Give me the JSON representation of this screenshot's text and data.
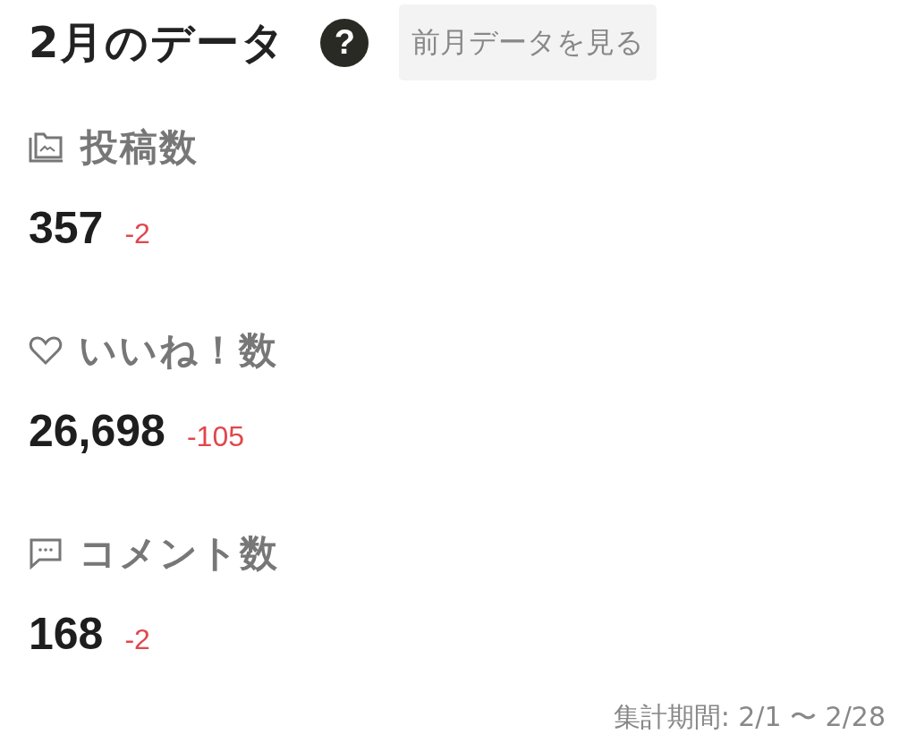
{
  "header": {
    "title": "2月のデータ",
    "help": "?",
    "button": "前月データを見る"
  },
  "stats": [
    {
      "kind": "posts",
      "label": "投稿数",
      "value": "357",
      "change": "-2"
    },
    {
      "kind": "likes",
      "label": "いいね！数",
      "value": "26,698",
      "change": "-105"
    },
    {
      "kind": "comments",
      "label": "コメント数",
      "value": "168",
      "change": "-2"
    }
  ],
  "footer": {
    "period": "集計期間: 2/1 〜 2/28"
  }
}
